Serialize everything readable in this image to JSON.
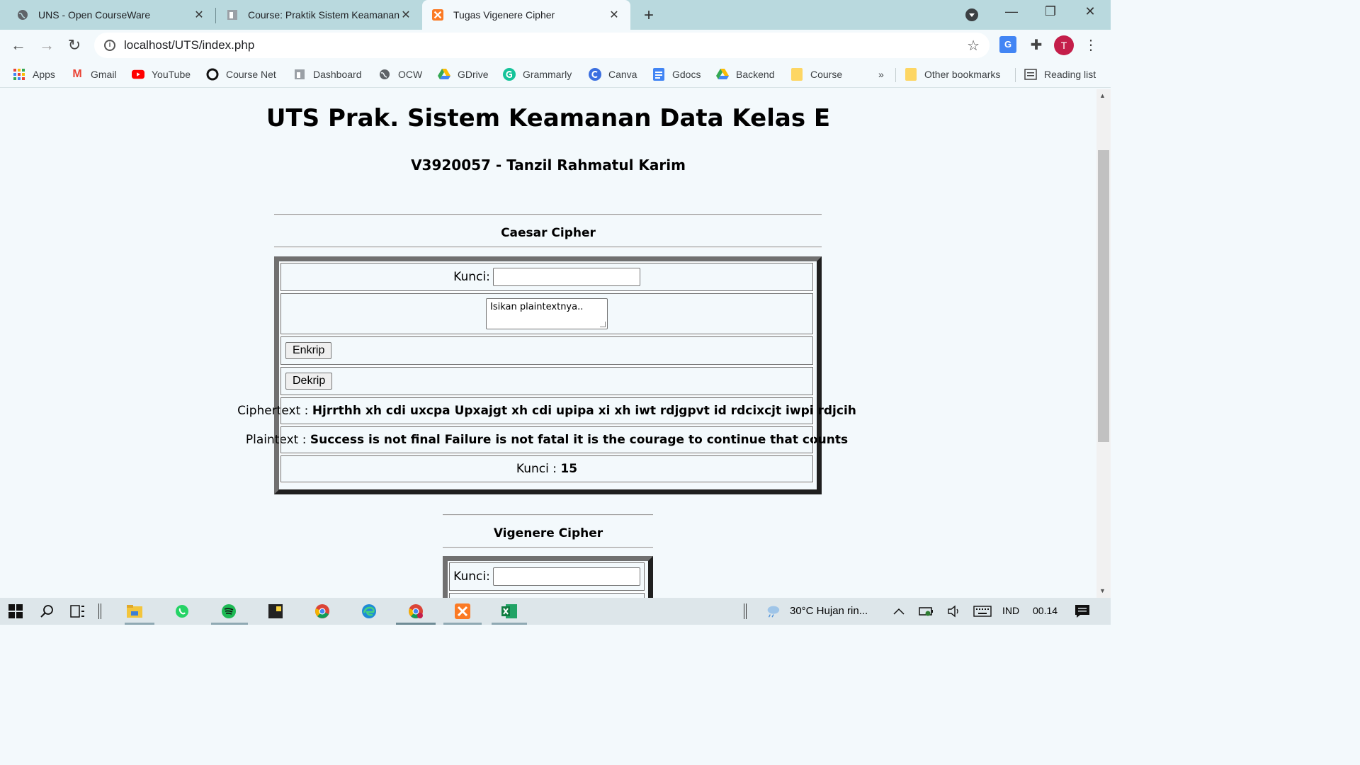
{
  "browser": {
    "tabs": [
      {
        "title": "UNS - Open CourseWare",
        "icon": "globe-icon"
      },
      {
        "title": "Course: Praktik Sistem Keamanan",
        "icon": "moodle-icon"
      },
      {
        "title": "Tugas Vigenere Cipher",
        "icon": "xampp-icon",
        "active": true
      }
    ],
    "new_tab": "+",
    "url": "localhost/UTS/index.php",
    "profile_initial": "T",
    "bookmarks": [
      {
        "label": "Apps",
        "icon": "apps-grid-icon"
      },
      {
        "label": "Gmail",
        "icon": "gmail-icon"
      },
      {
        "label": "YouTube",
        "icon": "youtube-icon"
      },
      {
        "label": "Course Net",
        "icon": "coursenet-icon"
      },
      {
        "label": "Dashboard",
        "icon": "dashboard-icon"
      },
      {
        "label": "OCW",
        "icon": "globe-icon"
      },
      {
        "label": "GDrive",
        "icon": "gdrive-icon"
      },
      {
        "label": "Grammarly",
        "icon": "grammarly-icon"
      },
      {
        "label": "Canva",
        "icon": "canva-icon"
      },
      {
        "label": "Gdocs",
        "icon": "gdocs-icon"
      },
      {
        "label": "Backend",
        "icon": "gdrive-icon"
      },
      {
        "label": "Course",
        "icon": "folder-icon"
      }
    ],
    "overflow": "»",
    "other_bookmarks": "Other bookmarks",
    "reading_list": "Reading list"
  },
  "page": {
    "title": "UTS Prak. Sistem Keamanan Data Kelas E",
    "subtitle": "V3920057 - Tanzil Rahmatul Karim",
    "caesar": {
      "heading": "Caesar Cipher",
      "key_label": "Kunci:",
      "plaintext_placeholder": "Isikan plaintextnya..",
      "encrypt_button": "Enkrip",
      "decrypt_button": "Dekrip",
      "ciphertext_label": "Ciphertext :",
      "ciphertext_value": "Hjrrthh xh cdi uxcpa Upxajgt xh cdi upipa xi xh iwt rdjgpvt id rdcixcjt iwpi rdjcih",
      "plaintext_label": "Plaintext :",
      "plaintext_value": "Success is not final Failure is not fatal it is the courage to continue that counts",
      "key_result_label": "Kunci :",
      "key_result_value": "15"
    },
    "vigenere": {
      "heading": "Vigenere Cipher",
      "key_label": "Kunci:"
    }
  },
  "taskbar": {
    "weather": "30°C  Hujan rin...",
    "language": "IND",
    "time": "00.14"
  },
  "colors": {
    "tabstrip": "#b9d9de",
    "page_bg": "#f3f9fc",
    "avatar": "#c41e4a"
  }
}
